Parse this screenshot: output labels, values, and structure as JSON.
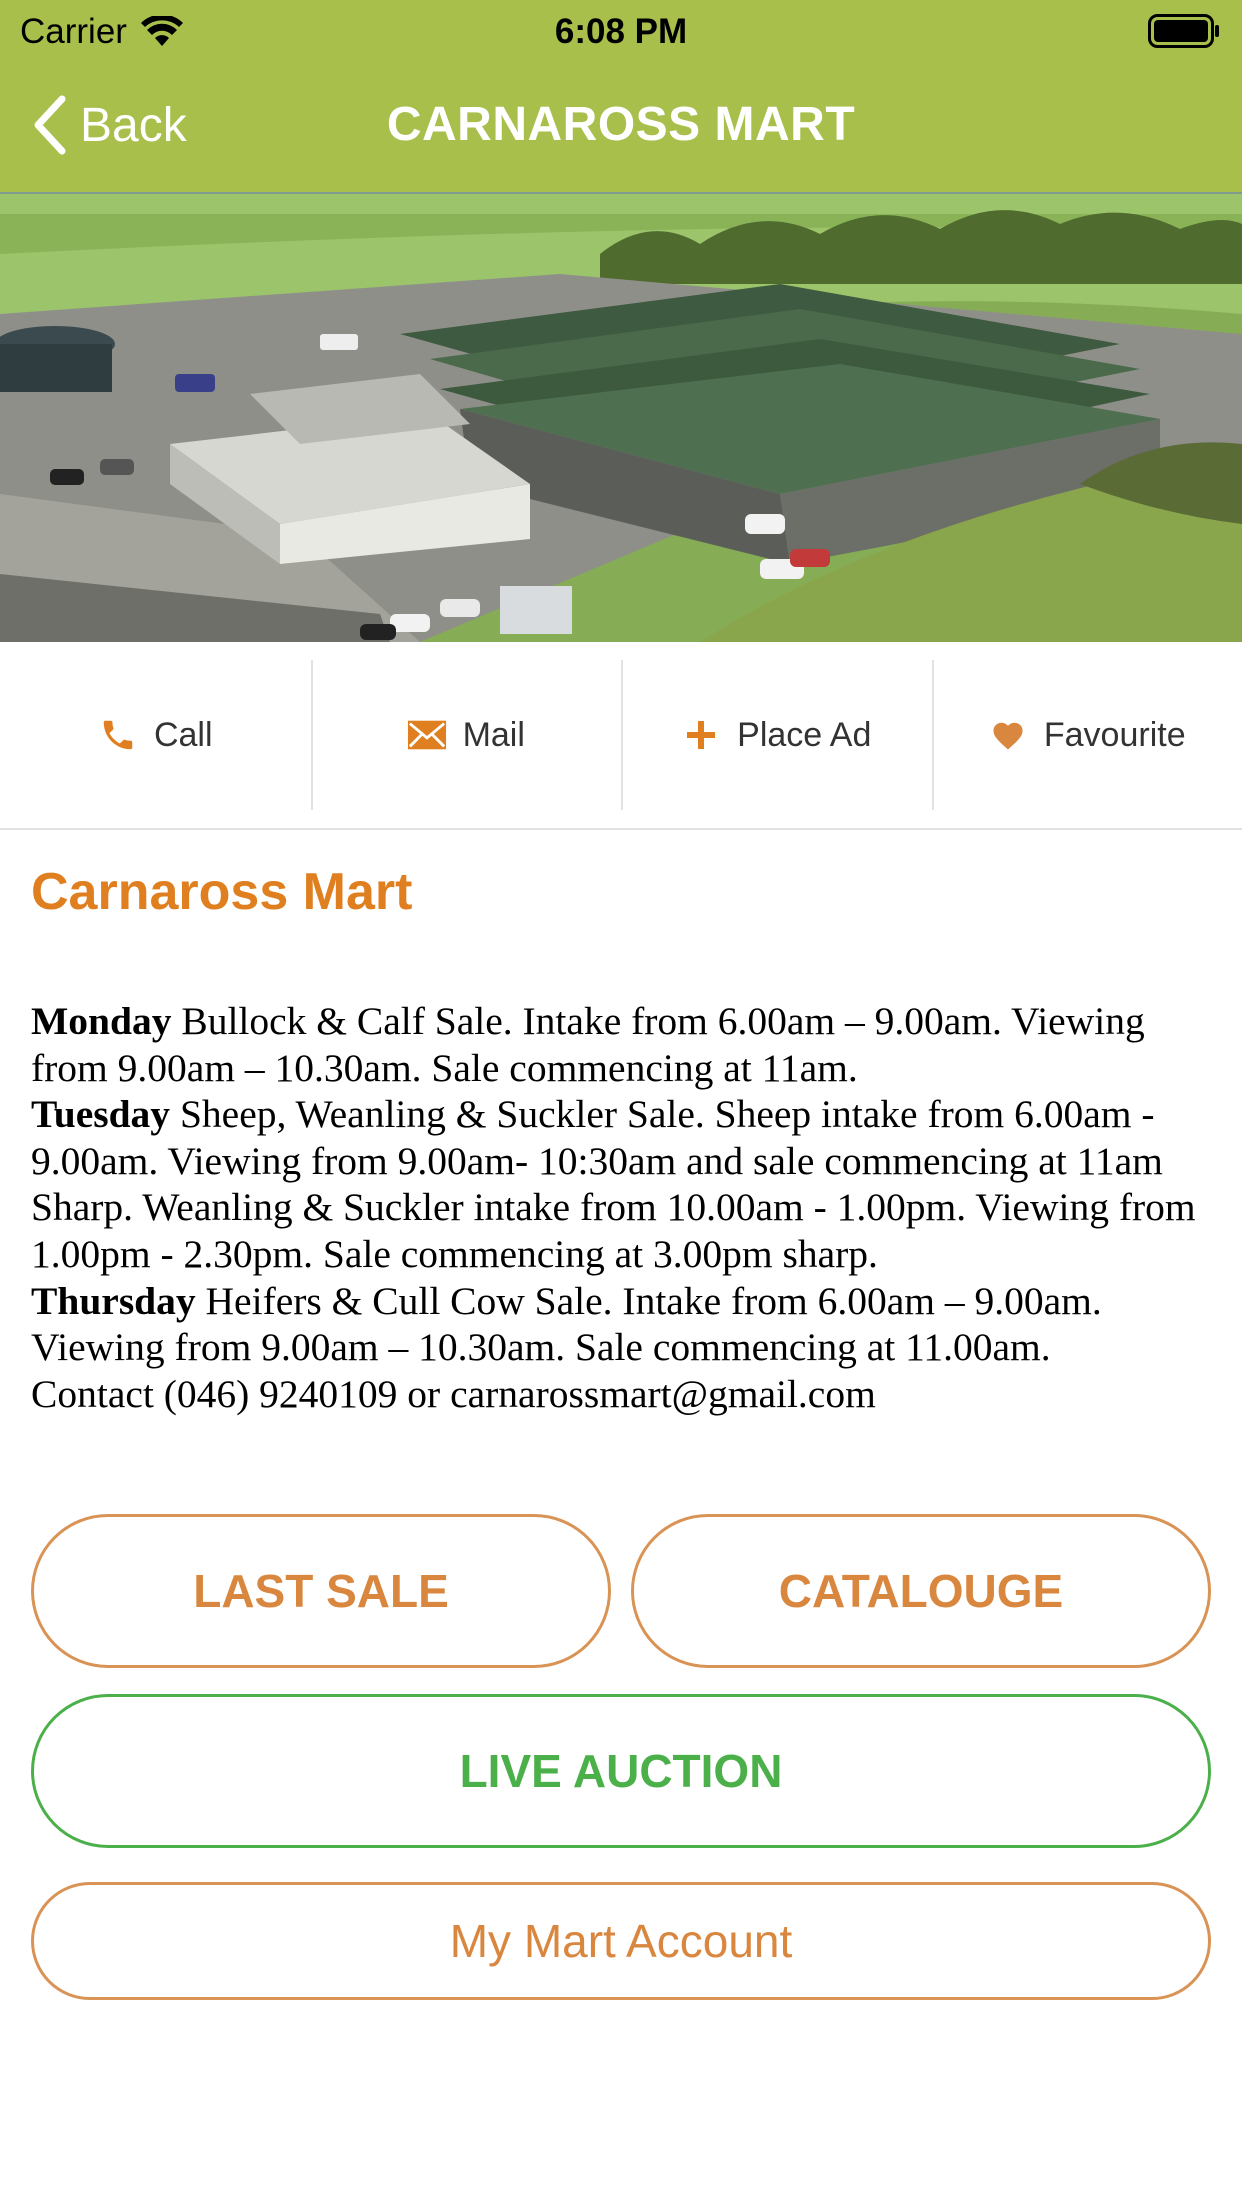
{
  "status_bar": {
    "carrier": "Carrier",
    "time": "6:08 PM"
  },
  "nav": {
    "back_label": "Back",
    "title": "CARNAROSS MART"
  },
  "actions": [
    {
      "label": "Call",
      "icon": "phone-icon"
    },
    {
      "label": "Mail",
      "icon": "mail-icon"
    },
    {
      "label": "Place Ad",
      "icon": "plus-icon"
    },
    {
      "label": "Favourite",
      "icon": "heart-icon"
    }
  ],
  "mart": {
    "name": "Carnaross Mart"
  },
  "schedule": {
    "monday_day": "Monday",
    "monday_text": " Bullock & Calf Sale. Intake from 6.00am – 9.00am. Viewing from 9.00am – 10.30am. Sale commencing at 11am.",
    "tuesday_day": "Tuesday",
    "tuesday_text": " Sheep, Weanling & Suckler Sale. Sheep intake from 6.00am - 9.00am. Viewing from 9.00am- 10:30am and sale commencing at 11am Sharp. Weanling & Suckler intake from 10.00am - 1.00pm. Viewing from 1.00pm - 2.30pm. Sale commencing at 3.00pm sharp.",
    "thursday_day": "Thursday",
    "thursday_text": " Heifers & Cull Cow Sale. Intake from 6.00am – 9.00am. Viewing from 9.00am – 10.30am. Sale commencing at 11.00am.",
    "contact": "Contact (046) 9240109 or carnarossmart@gmail.com"
  },
  "buttons": {
    "last_sale": "LAST SALE",
    "catalogue": "CATALOUGE",
    "live_auction": "LIVE AUCTION",
    "my_account": "My Mart Account"
  },
  "colors": {
    "nav_bar": "#a8bf4c",
    "accent_orange": "#e07f1f",
    "live_green": "#4cb04a"
  }
}
